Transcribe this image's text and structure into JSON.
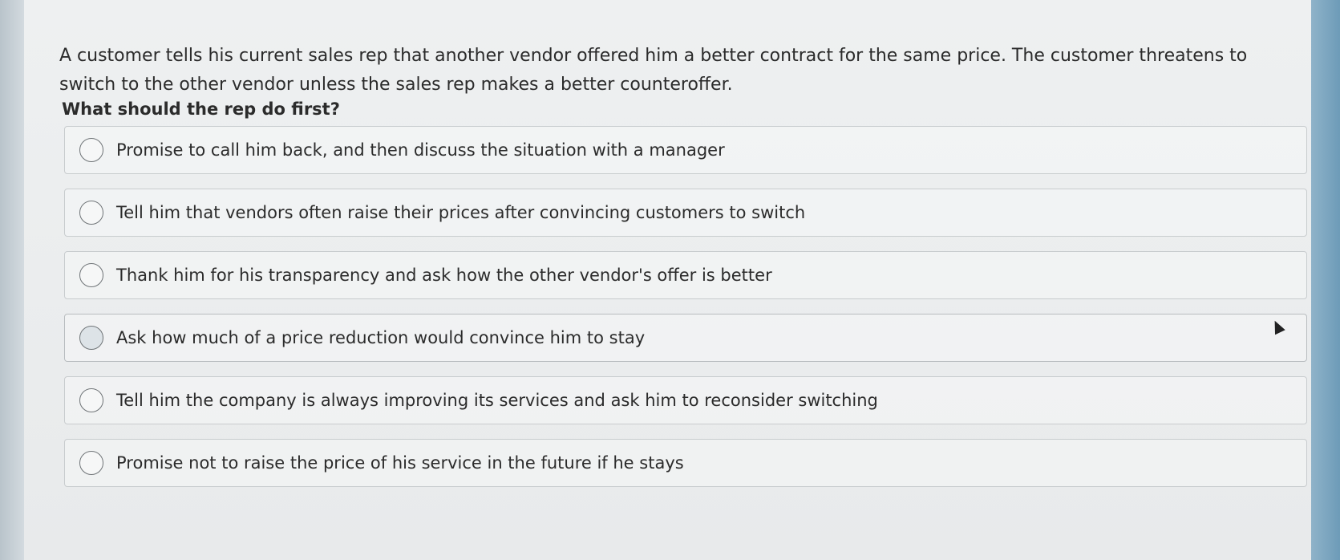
{
  "question": {
    "text": "A customer tells his current sales rep that another vendor offered him a better contract for the same price. The customer threatens to switch to the other vendor unless the sales rep makes a better counteroffer.",
    "prompt": "What should the rep do first?"
  },
  "options": [
    {
      "label": "Promise to call him back, and then discuss the situation with a manager"
    },
    {
      "label": "Tell him that vendors often raise their prices after convincing customers to switch"
    },
    {
      "label": "Thank him for his transparency and ask how the other vendor's offer is better"
    },
    {
      "label": "Ask how much of a price reduction would convince him to stay"
    },
    {
      "label": "Tell him the company is always improving its services and ask him to reconsider switching"
    },
    {
      "label": "Promise not to raise the price of his service in the future if he stays"
    }
  ]
}
